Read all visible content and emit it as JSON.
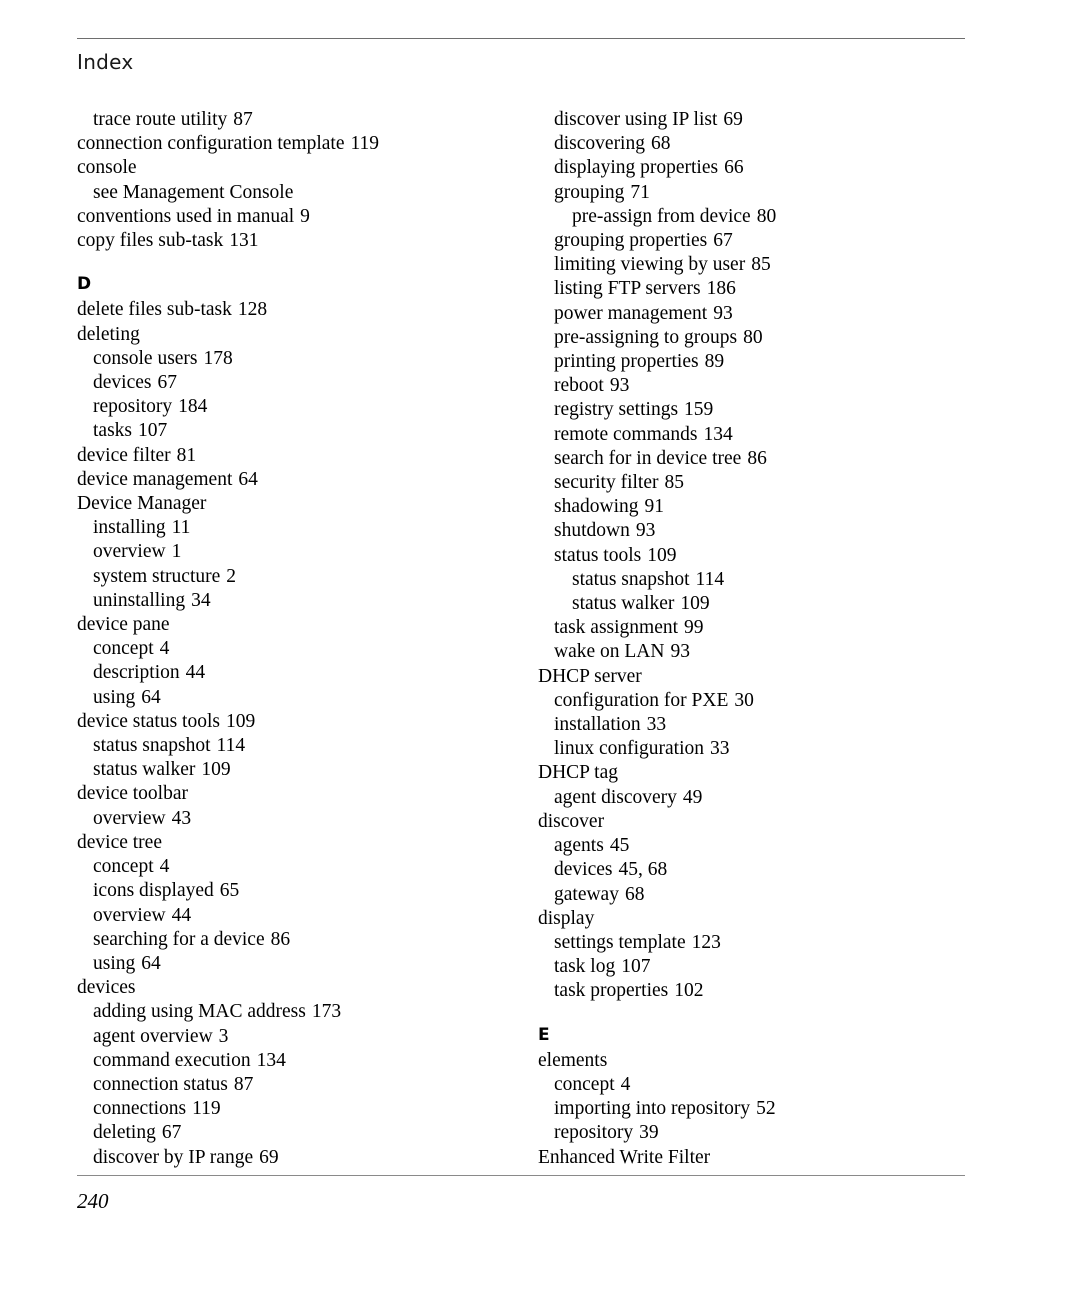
{
  "document": {
    "running_head": "Index",
    "page_number": "240",
    "header_rule_color": "#6e6e6e",
    "footer_rule_color": "#8a8a8a",
    "text_color": "#000000"
  },
  "columns": {
    "left": [
      {
        "kind": "entry",
        "level": 1,
        "text": "trace route utility",
        "locator": "87"
      },
      {
        "kind": "entry",
        "level": 0,
        "text": "connection configuration template",
        "locator": "119"
      },
      {
        "kind": "entry",
        "level": 0,
        "text": "console",
        "locator": ""
      },
      {
        "kind": "entry",
        "level": 1,
        "text": "see Management Console",
        "locator": ""
      },
      {
        "kind": "entry",
        "level": 0,
        "text": "conventions used in manual",
        "locator": "9"
      },
      {
        "kind": "entry",
        "level": 0,
        "text": "copy files sub-task",
        "locator": "131"
      },
      {
        "kind": "letter",
        "text": "D"
      },
      {
        "kind": "entry",
        "level": 0,
        "text": "delete files sub-task",
        "locator": "128"
      },
      {
        "kind": "entry",
        "level": 0,
        "text": "deleting",
        "locator": ""
      },
      {
        "kind": "entry",
        "level": 1,
        "text": "console users",
        "locator": "178"
      },
      {
        "kind": "entry",
        "level": 1,
        "text": "devices",
        "locator": "67"
      },
      {
        "kind": "entry",
        "level": 1,
        "text": "repository",
        "locator": "184"
      },
      {
        "kind": "entry",
        "level": 1,
        "text": "tasks",
        "locator": "107"
      },
      {
        "kind": "entry",
        "level": 0,
        "text": "device filter",
        "locator": "81"
      },
      {
        "kind": "entry",
        "level": 0,
        "text": "device management",
        "locator": "64"
      },
      {
        "kind": "entry",
        "level": 0,
        "text": "Device Manager",
        "locator": ""
      },
      {
        "kind": "entry",
        "level": 1,
        "text": "installing",
        "locator": "11"
      },
      {
        "kind": "entry",
        "level": 1,
        "text": "overview",
        "locator": "1"
      },
      {
        "kind": "entry",
        "level": 1,
        "text": "system structure",
        "locator": "2"
      },
      {
        "kind": "entry",
        "level": 1,
        "text": "uninstalling",
        "locator": "34"
      },
      {
        "kind": "entry",
        "level": 0,
        "text": "device pane",
        "locator": ""
      },
      {
        "kind": "entry",
        "level": 1,
        "text": "concept",
        "locator": "4"
      },
      {
        "kind": "entry",
        "level": 1,
        "text": "description",
        "locator": "44"
      },
      {
        "kind": "entry",
        "level": 1,
        "text": "using",
        "locator": "64"
      },
      {
        "kind": "entry",
        "level": 0,
        "text": "device status tools",
        "locator": "109"
      },
      {
        "kind": "entry",
        "level": 1,
        "text": "status snapshot",
        "locator": "114"
      },
      {
        "kind": "entry",
        "level": 1,
        "text": "status walker",
        "locator": "109"
      },
      {
        "kind": "entry",
        "level": 0,
        "text": "device toolbar",
        "locator": ""
      },
      {
        "kind": "entry",
        "level": 1,
        "text": "overview",
        "locator": "43"
      },
      {
        "kind": "entry",
        "level": 0,
        "text": "device tree",
        "locator": ""
      },
      {
        "kind": "entry",
        "level": 1,
        "text": "concept",
        "locator": "4"
      },
      {
        "kind": "entry",
        "level": 1,
        "text": "icons displayed",
        "locator": "65"
      },
      {
        "kind": "entry",
        "level": 1,
        "text": "overview",
        "locator": "44"
      },
      {
        "kind": "entry",
        "level": 1,
        "text": "searching for a device",
        "locator": "86"
      },
      {
        "kind": "entry",
        "level": 1,
        "text": "using",
        "locator": "64"
      },
      {
        "kind": "entry",
        "level": 0,
        "text": "devices",
        "locator": ""
      },
      {
        "kind": "entry",
        "level": 1,
        "text": "adding using MAC address",
        "locator": "173"
      },
      {
        "kind": "entry",
        "level": 1,
        "text": "agent overview",
        "locator": "3"
      },
      {
        "kind": "entry",
        "level": 1,
        "text": "command execution",
        "locator": "134"
      },
      {
        "kind": "entry",
        "level": 1,
        "text": "connection status",
        "locator": "87"
      },
      {
        "kind": "entry",
        "level": 1,
        "text": "connections",
        "locator": "119"
      },
      {
        "kind": "entry",
        "level": 1,
        "text": "deleting",
        "locator": "67"
      },
      {
        "kind": "entry",
        "level": 1,
        "text": "discover by IP range",
        "locator": "69"
      }
    ],
    "right": [
      {
        "kind": "entry",
        "level": 1,
        "text": "discover using IP list",
        "locator": "69"
      },
      {
        "kind": "entry",
        "level": 1,
        "text": "discovering",
        "locator": "68"
      },
      {
        "kind": "entry",
        "level": 1,
        "text": "displaying properties",
        "locator": "66"
      },
      {
        "kind": "entry",
        "level": 1,
        "text": "grouping",
        "locator": "71"
      },
      {
        "kind": "entry",
        "level": 2,
        "text": "pre-assign from device",
        "locator": "80"
      },
      {
        "kind": "entry",
        "level": 1,
        "text": "grouping properties",
        "locator": "67"
      },
      {
        "kind": "entry",
        "level": 1,
        "text": "limiting viewing by user",
        "locator": "85"
      },
      {
        "kind": "entry",
        "level": 1,
        "text": "listing FTP servers",
        "locator": "186"
      },
      {
        "kind": "entry",
        "level": 1,
        "text": "power management",
        "locator": "93"
      },
      {
        "kind": "entry",
        "level": 1,
        "text": "pre-assigning to groups",
        "locator": "80"
      },
      {
        "kind": "entry",
        "level": 1,
        "text": "printing properties",
        "locator": "89"
      },
      {
        "kind": "entry",
        "level": 1,
        "text": "reboot",
        "locator": "93"
      },
      {
        "kind": "entry",
        "level": 1,
        "text": "registry settings",
        "locator": "159"
      },
      {
        "kind": "entry",
        "level": 1,
        "text": "remote commands",
        "locator": "134"
      },
      {
        "kind": "entry",
        "level": 1,
        "text": "search for in device tree",
        "locator": "86"
      },
      {
        "kind": "entry",
        "level": 1,
        "text": "security filter",
        "locator": "85"
      },
      {
        "kind": "entry",
        "level": 1,
        "text": "shadowing",
        "locator": "91"
      },
      {
        "kind": "entry",
        "level": 1,
        "text": "shutdown",
        "locator": "93"
      },
      {
        "kind": "entry",
        "level": 1,
        "text": "status tools",
        "locator": "109"
      },
      {
        "kind": "entry",
        "level": 2,
        "text": "status snapshot",
        "locator": "114"
      },
      {
        "kind": "entry",
        "level": 2,
        "text": "status walker",
        "locator": "109"
      },
      {
        "kind": "entry",
        "level": 1,
        "text": "task assignment",
        "locator": "99"
      },
      {
        "kind": "entry",
        "level": 1,
        "text": "wake on LAN",
        "locator": "93"
      },
      {
        "kind": "entry",
        "level": 0,
        "text": "DHCP server",
        "locator": ""
      },
      {
        "kind": "entry",
        "level": 1,
        "text": "configuration for PXE",
        "locator": "30"
      },
      {
        "kind": "entry",
        "level": 1,
        "text": "installation",
        "locator": "33"
      },
      {
        "kind": "entry",
        "level": 1,
        "text": "linux configuration",
        "locator": "33"
      },
      {
        "kind": "entry",
        "level": 0,
        "text": "DHCP tag",
        "locator": ""
      },
      {
        "kind": "entry",
        "level": 1,
        "text": "agent discovery",
        "locator": "49"
      },
      {
        "kind": "entry",
        "level": 0,
        "text": "discover",
        "locator": ""
      },
      {
        "kind": "entry",
        "level": 1,
        "text": "agents",
        "locator": "45"
      },
      {
        "kind": "entry",
        "level": 1,
        "text": "devices",
        "locator": "45, 68"
      },
      {
        "kind": "entry",
        "level": 1,
        "text": "gateway",
        "locator": "68"
      },
      {
        "kind": "entry",
        "level": 0,
        "text": "display",
        "locator": ""
      },
      {
        "kind": "entry",
        "level": 1,
        "text": "settings template",
        "locator": "123"
      },
      {
        "kind": "entry",
        "level": 1,
        "text": "task log",
        "locator": "107"
      },
      {
        "kind": "entry",
        "level": 1,
        "text": "task properties",
        "locator": "102"
      },
      {
        "kind": "letter",
        "text": "E"
      },
      {
        "kind": "entry",
        "level": 0,
        "text": "elements",
        "locator": ""
      },
      {
        "kind": "entry",
        "level": 1,
        "text": "concept",
        "locator": "4"
      },
      {
        "kind": "entry",
        "level": 1,
        "text": "importing into repository",
        "locator": "52"
      },
      {
        "kind": "entry",
        "level": 1,
        "text": "repository",
        "locator": "39"
      },
      {
        "kind": "entry",
        "level": 0,
        "text": "Enhanced Write Filter",
        "locator": ""
      }
    ]
  }
}
